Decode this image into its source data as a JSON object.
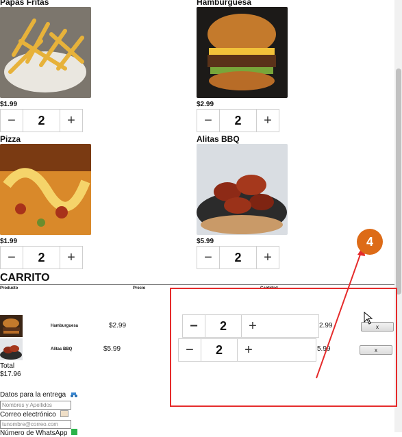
{
  "products": [
    {
      "name": "Papas Fritas",
      "price": "$1.99",
      "qty": "2"
    },
    {
      "name": "Hamburguesa",
      "price": "$2.99",
      "qty": "2"
    },
    {
      "name": "Pizza",
      "price": "$1.99",
      "qty": "2"
    },
    {
      "name": "Alitas BBQ",
      "price": "$5.99",
      "qty": "2"
    }
  ],
  "stepper": {
    "minus": "−",
    "plus": "+"
  },
  "cart": {
    "title": "CARRITO",
    "headers": {
      "product": "Producto",
      "price": "Precio",
      "qty": "Cantidad"
    },
    "rows": [
      {
        "name": "Hamburguesa",
        "price": "$2.99",
        "qty": "2",
        "subtotal": "2.99",
        "remove": "x"
      },
      {
        "name": "Alitas BBQ",
        "price": "$5.99",
        "qty": "2",
        "subtotal": "5.99",
        "remove": "x"
      }
    ],
    "total_label": "Total",
    "total_value": "$17.96"
  },
  "delivery": {
    "title": "Datos para la entrega",
    "name_placeholder": "Nombres y Apellidos",
    "email_label": "Correo electrónico",
    "email_placeholder": "tunombre@correo.com",
    "whatsapp_label": "Número de WhatsApp"
  },
  "annotation": {
    "badge": "4"
  }
}
